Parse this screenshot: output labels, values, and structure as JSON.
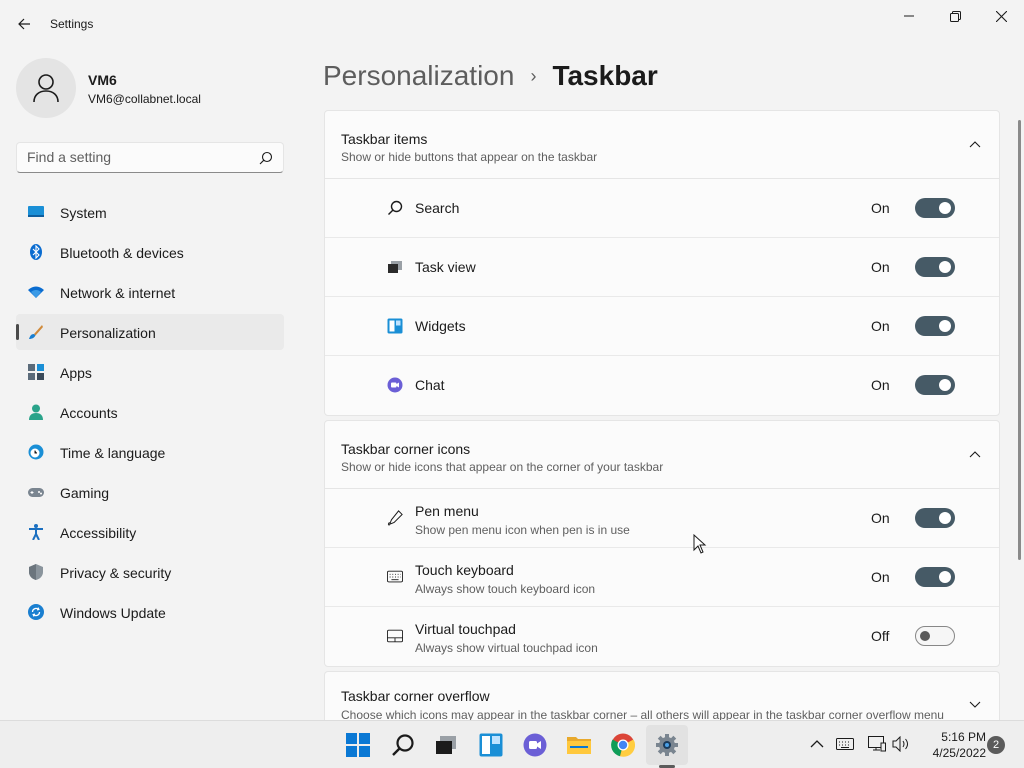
{
  "window": {
    "title": "Settings"
  },
  "profile": {
    "name": "VM6",
    "email": "VM6@collabnet.local"
  },
  "search": {
    "placeholder": "Find a setting"
  },
  "nav": {
    "items": [
      {
        "label": "System",
        "icon": "monitor-icon"
      },
      {
        "label": "Bluetooth & devices",
        "icon": "bluetooth-icon"
      },
      {
        "label": "Network & internet",
        "icon": "wifi-icon"
      },
      {
        "label": "Personalization",
        "icon": "brush-icon",
        "selected": true
      },
      {
        "label": "Apps",
        "icon": "apps-icon"
      },
      {
        "label": "Accounts",
        "icon": "person-icon"
      },
      {
        "label": "Time & language",
        "icon": "clock-globe-icon"
      },
      {
        "label": "Gaming",
        "icon": "gamepad-icon"
      },
      {
        "label": "Accessibility",
        "icon": "accessibility-icon"
      },
      {
        "label": "Privacy & security",
        "icon": "shield-icon"
      },
      {
        "label": "Windows Update",
        "icon": "update-icon"
      }
    ]
  },
  "breadcrumb": {
    "parent": "Personalization",
    "separator": "›",
    "current": "Taskbar"
  },
  "sections": {
    "items": {
      "title": "Taskbar items",
      "subtitle": "Show or hide buttons that appear on the taskbar",
      "rows": [
        {
          "label": "Search",
          "state": "On"
        },
        {
          "label": "Task view",
          "state": "On"
        },
        {
          "label": "Widgets",
          "state": "On"
        },
        {
          "label": "Chat",
          "state": "On"
        }
      ]
    },
    "corner": {
      "title": "Taskbar corner icons",
      "subtitle": "Show or hide icons that appear on the corner of your taskbar",
      "rows": [
        {
          "label": "Pen menu",
          "sub": "Show pen menu icon when pen is in use",
          "state": "On"
        },
        {
          "label": "Touch keyboard",
          "sub": "Always show touch keyboard icon",
          "state": "On"
        },
        {
          "label": "Virtual touchpad",
          "sub": "Always show virtual touchpad icon",
          "state": "Off"
        }
      ]
    },
    "overflow": {
      "title": "Taskbar corner overflow",
      "subtitle": "Choose which icons may appear in the taskbar corner – all others will appear in the taskbar corner overflow menu"
    }
  },
  "taskbar": {
    "time": "5:16 PM",
    "date": "4/25/2022",
    "notifications": "2"
  },
  "colors": {
    "toggle_on": "#465a66",
    "accent": "#0067c0",
    "background": "#f3f3f3"
  }
}
